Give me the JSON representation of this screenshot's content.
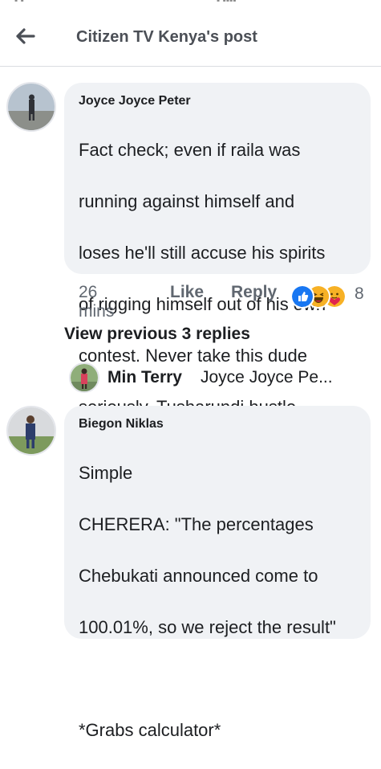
{
  "header": {
    "title": "Citizen TV Kenya's post"
  },
  "comment1": {
    "author": "Joyce Joyce Peter",
    "lines": [
      "Fact check; even if raila was",
      "running against himself and",
      "loses he'll still accuse his spirits",
      "of rigging himself out of his own",
      "contest. Never take this dude",
      "seriously.  Tusharundi hustle"
    ],
    "time": "26 mins",
    "like_label": "Like",
    "reply_label": "Reply",
    "reaction_count": "8",
    "reactions": [
      "like-icon",
      "haha-icon",
      "care-icon"
    ]
  },
  "view_previous": "View previous 3 replies",
  "reply_preview": {
    "author": "Min Terry",
    "snippet": "Joyce Joyce Pe..."
  },
  "comment2": {
    "author": "Biegon Niklas",
    "lines": [
      "Simple",
      "CHERERA: \"The percentages",
      "Chebukati announced come to",
      "100.01%, so we reject the result\"",
      "",
      "*Grabs calculator*"
    ]
  },
  "colors": {
    "bubble": "#f0f2f5",
    "like_blue": "#1877f2",
    "haha_yellow": "#f7b125"
  }
}
